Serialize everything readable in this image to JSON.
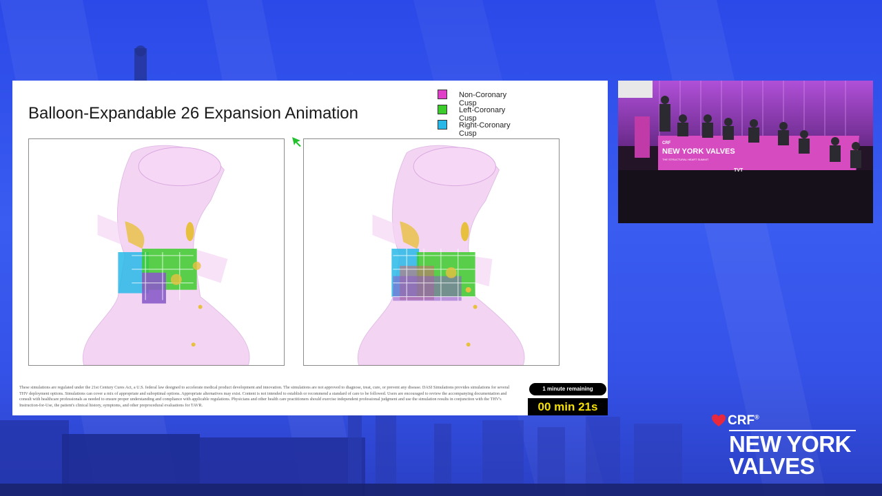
{
  "slide": {
    "title": "Balloon-Expandable 26 Expansion Animation",
    "legend": [
      {
        "label": "Non-Coronary Cusp",
        "color": "#e040c8"
      },
      {
        "label": "Left-Coronary Cusp",
        "color": "#3ccc2c"
      },
      {
        "label": "Right-Coronary Cusp",
        "color": "#28b8e8"
      }
    ],
    "disclaimer": "These simulations are regulated under the 21st Century Cures Act, a U.S. federal law designed to accelerate medical product development and innovation. The simulations are not approved to diagnose, treat, cure, or prevent any disease. DASI Simulations provides simulations for several THV deployment options. Simulations can cover a mix of appropriate and suboptimal options. Appropriate alternatives may exist. Content is not intended to establish or recommend a standard of care to be followed. Users are encouraged to review the accompanying documentation and consult with healthcare professionals as needed to ensure proper understanding and compliance with applicable regulations. Physicians and other health care practitioners should exercise independent professional judgment and use the simulation results in conjunction with the THV's Instruction-for-Use, the patient's clinical history, symptoms, and other preprocedural evaluations for TAVR."
  },
  "timer": {
    "label": "1 minute remaining",
    "value": "00 min 21s"
  },
  "video": {
    "banner_text": "NEW YORK VALVES",
    "banner_sub": "THE STRUCTURAL HEART SUMMIT",
    "crf_text": "CRF",
    "tvt_text": "TVT"
  },
  "brand": {
    "crf": "CRF",
    "registered": "®",
    "line1": "NEW YORK",
    "line2": "VALVES"
  },
  "colors": {
    "background": "#3552e8",
    "accent_magenta": "#e040c8",
    "timer_yellow": "#f5e000"
  }
}
